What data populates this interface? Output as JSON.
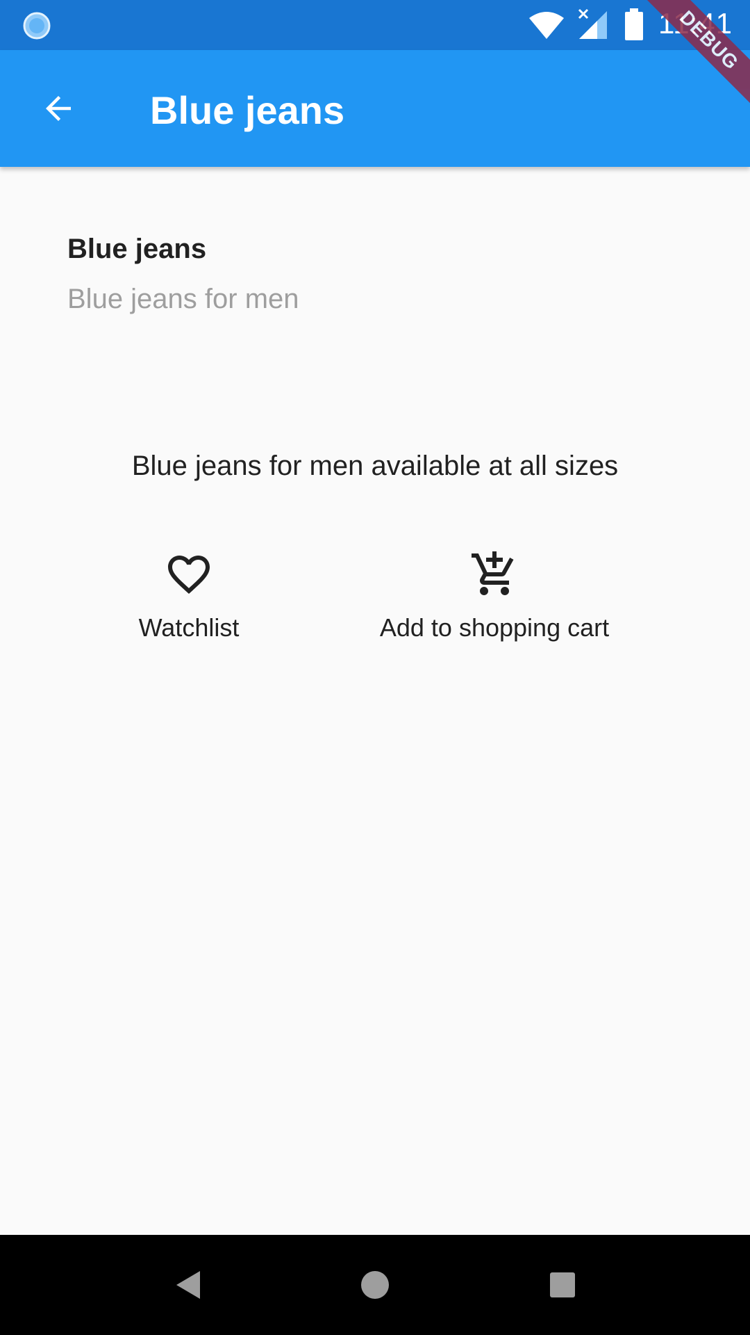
{
  "status_bar": {
    "time": "11:41",
    "left_icon": "sync-icon",
    "icons": [
      "wifi-icon",
      "signal-no-data-icon",
      "battery-full-icon"
    ]
  },
  "debug_banner": "DEBUG",
  "app_bar": {
    "title": "Blue jeans",
    "back_icon": "arrow-back-icon",
    "color": "#2196f3"
  },
  "product": {
    "title": "Blue jeans",
    "subtitle": "Blue jeans for men",
    "description": "Blue jeans for men available at all sizes"
  },
  "actions": [
    {
      "label": "Watchlist",
      "icon": "heart-outline-icon"
    },
    {
      "label": "Add to shopping cart",
      "icon": "add-shopping-cart-icon"
    }
  ],
  "nav_bar": {
    "buttons": [
      "back-triangle-icon",
      "home-circle-icon",
      "recents-square-icon"
    ]
  }
}
